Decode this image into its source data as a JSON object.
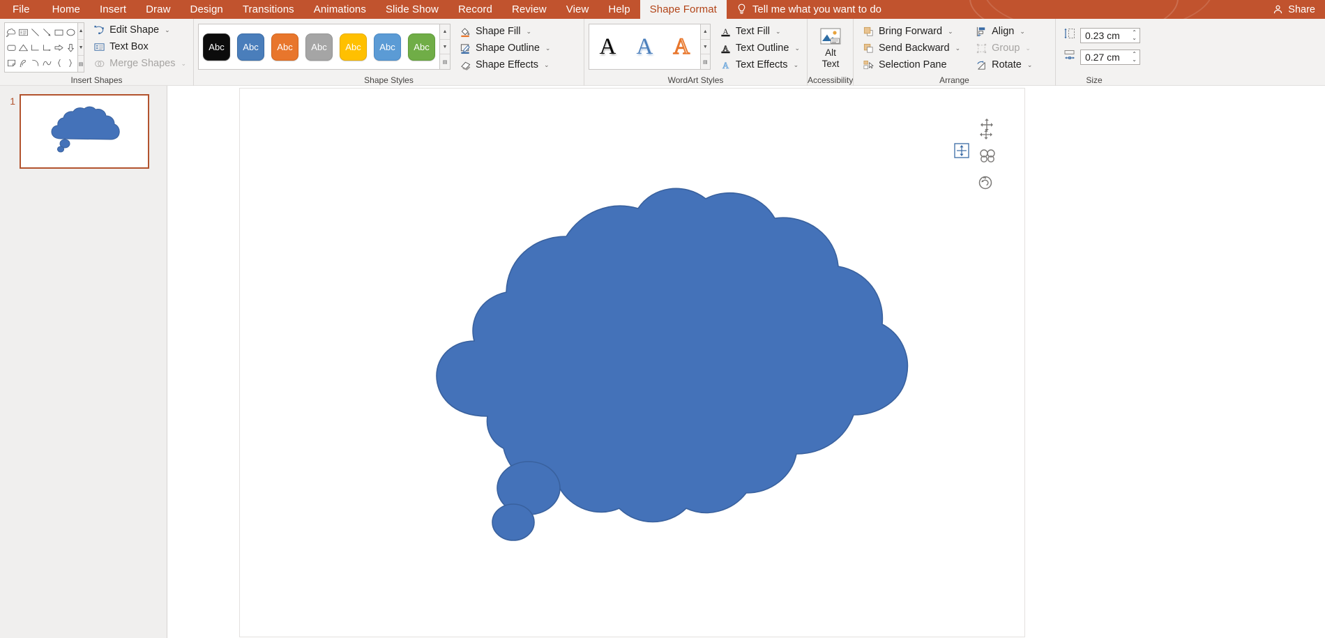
{
  "tabs": [
    {
      "label": "File",
      "active": false
    },
    {
      "label": "Home",
      "active": false
    },
    {
      "label": "Insert",
      "active": false
    },
    {
      "label": "Draw",
      "active": false
    },
    {
      "label": "Design",
      "active": false
    },
    {
      "label": "Transitions",
      "active": false
    },
    {
      "label": "Animations",
      "active": false
    },
    {
      "label": "Slide Show",
      "active": false
    },
    {
      "label": "Record",
      "active": false
    },
    {
      "label": "Review",
      "active": false
    },
    {
      "label": "View",
      "active": false
    },
    {
      "label": "Help",
      "active": false
    },
    {
      "label": "Shape Format",
      "active": true
    }
  ],
  "tellme": {
    "label": "Tell me what you want to do",
    "icon": "lightbulb-icon"
  },
  "share": {
    "label": "Share",
    "icon": "share-person-icon"
  },
  "colors": {
    "ribbon_accent": "#C1532E",
    "active_tab_text": "#B24418",
    "ribbon_bg": "#F3F2F1",
    "thumb_selected_border": "#B2532E",
    "shape_fill": "#4472B9",
    "shape_outline": "#39619E"
  },
  "groups": {
    "insert_shapes": {
      "label": "Insert Shapes",
      "shapes": [
        "cloud-shape",
        "text-box-shape",
        "line-shape",
        "line-arrow-shape",
        "rectangle-shape",
        "oval-shape",
        "rounded-rectangle-shape",
        "triangle-shape",
        "elbow-connector-shape",
        "elbow-arrow-connector-shape",
        "right-arrow-shape",
        "down-arrow-shape",
        "folded-corner-shape",
        "freeform-scribble-shape",
        "arc-shape",
        "curve-shape",
        "left-brace-shape",
        "right-brace-shape"
      ],
      "scroll": [
        "scroll-up-icon",
        "scroll-down-icon",
        "more-shapes-icon"
      ],
      "commands": [
        {
          "label": "Edit Shape",
          "icon": "edit-shape-icon",
          "chevron": true,
          "disabled": false
        },
        {
          "label": "Text Box",
          "icon": "text-box-icon",
          "chevron": false,
          "disabled": false
        },
        {
          "label": "Merge Shapes",
          "icon": "merge-shapes-icon",
          "chevron": true,
          "disabled": true
        }
      ]
    },
    "shape_styles": {
      "label": "Shape Styles",
      "swatch_text": "Abc",
      "swatches": [
        {
          "name": "style-black",
          "fill": "#0C0C0C",
          "border": "#2B2B2B",
          "text": "#FFFFFF"
        },
        {
          "name": "style-blue",
          "fill": "#4A7EBB",
          "border": "#3A6BA5",
          "text": "#FFFFFF"
        },
        {
          "name": "style-orange",
          "fill": "#E8762C",
          "border": "#D2661F",
          "text": "#FFFFFF"
        },
        {
          "name": "style-gray",
          "fill": "#A5A5A5",
          "border": "#949494",
          "text": "#FFFFFF"
        },
        {
          "name": "style-yellow",
          "fill": "#FFC000",
          "border": "#E6AC00",
          "text": "#FFFFFF"
        },
        {
          "name": "style-lightblue",
          "fill": "#5B9BD5",
          "border": "#4A89C4",
          "text": "#FFFFFF"
        },
        {
          "name": "style-green",
          "fill": "#70AD47",
          "border": "#5F9A3A",
          "text": "#FFFFFF"
        }
      ],
      "scroll": [
        "scroll-up-icon",
        "scroll-down-icon",
        "more-styles-icon"
      ],
      "commands": [
        {
          "label": "Shape Fill",
          "icon": "shape-fill-icon",
          "underline": "#E8762C",
          "chevron": true
        },
        {
          "label": "Shape Outline",
          "icon": "shape-outline-icon",
          "underline": "#3A6BA5",
          "chevron": true
        },
        {
          "label": "Shape Effects",
          "icon": "shape-effects-icon",
          "underline": "",
          "chevron": true
        }
      ]
    },
    "wordart_styles": {
      "label": "WordArt Styles",
      "samples": [
        {
          "name": "wordart-black",
          "glyph": "A",
          "color": "#000000"
        },
        {
          "name": "wordart-blue",
          "glyph": "A",
          "color": "#4A7EBB"
        },
        {
          "name": "wordart-orange-outline",
          "glyph": "A",
          "color": "#F0A070"
        }
      ],
      "scroll": [
        "scroll-up-icon",
        "scroll-down-icon",
        "more-wordart-icon"
      ],
      "commands": [
        {
          "label": "Text Fill",
          "icon": "text-fill-icon",
          "chevron": true
        },
        {
          "label": "Text Outline",
          "icon": "text-outline-icon",
          "chevron": true
        },
        {
          "label": "Text Effects",
          "icon": "text-effects-icon",
          "chevron": true
        }
      ]
    },
    "accessibility": {
      "label": "Accessibility",
      "alt_text_line1": "Alt",
      "alt_text_line2": "Text",
      "icon": "alt-text-picture-icon"
    },
    "arrange": {
      "label": "Arrange",
      "commands": [
        {
          "label": "Bring Forward",
          "icon": "bring-forward-icon",
          "chevron": true,
          "disabled": false
        },
        {
          "label": "Send Backward",
          "icon": "send-backward-icon",
          "chevron": true,
          "disabled": false
        },
        {
          "label": "Selection Pane",
          "icon": "selection-pane-icon",
          "chevron": false,
          "disabled": false
        },
        {
          "label": "Align",
          "icon": "align-icon",
          "chevron": true,
          "disabled": false
        },
        {
          "label": "Group",
          "icon": "group-icon",
          "chevron": true,
          "disabled": true
        },
        {
          "label": "Rotate",
          "icon": "rotate-icon",
          "chevron": true,
          "disabled": false
        }
      ]
    },
    "size": {
      "label": "Size",
      "height": {
        "icon": "shape-height-icon",
        "value": "0.23 cm"
      },
      "width": {
        "icon": "shape-width-icon",
        "value": "0.27 cm"
      }
    }
  },
  "slide_panel": {
    "slides": [
      {
        "number": "1",
        "selected": true,
        "thumbnail_shape": "cloud-shape"
      }
    ]
  },
  "canvas": {
    "shape": {
      "name": "cloud-callout-shape",
      "fill": "#4472B9",
      "outline": "#39619E"
    },
    "handles": [
      {
        "name": "move-handle-icon"
      },
      {
        "name": "vertical-resize-handle-icon"
      },
      {
        "name": "adjust-handle-icon"
      },
      {
        "name": "rotate-handle-icon"
      }
    ]
  }
}
